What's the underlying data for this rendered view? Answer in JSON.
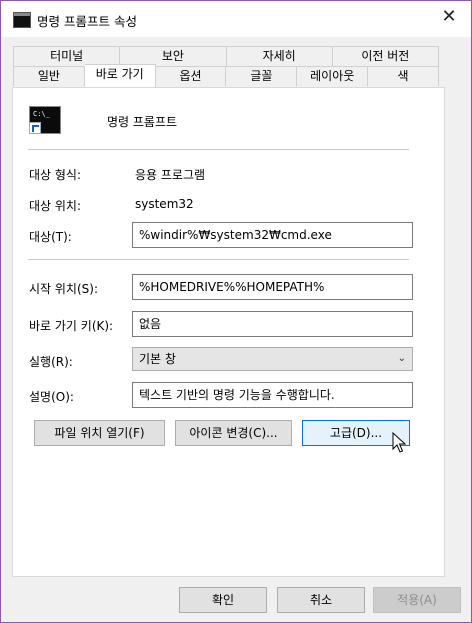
{
  "window": {
    "title": "명령 프롬프트 속성",
    "close_glyph": "✕",
    "border_color": "#8a5ba8"
  },
  "tabs": {
    "row1": [
      "터미널",
      "보안",
      "자세히",
      "이전 버전"
    ],
    "row2": [
      "일반",
      "바로 가기",
      "옵션",
      "글꼴",
      "레이아웃",
      "색"
    ],
    "active": "바로 가기"
  },
  "header": {
    "name": "명령 프롬프트",
    "icon": "cmd-shortcut-icon"
  },
  "fields": {
    "type_label": "대상 형식:",
    "type_value": "응용 프로그램",
    "location_label": "대상 위치:",
    "location_value": "system32",
    "target_label": "대상(T):",
    "target_value": "%windir%₩system32₩cmd.exe",
    "start_label": "시작 위치(S):",
    "start_value": "%HOMEDRIVE%%HOMEPATH%",
    "hotkey_label": "바로 가기 키(K):",
    "hotkey_value": "없음",
    "run_label": "실행(R):",
    "run_value": "기본 창",
    "comment_label": "설명(O):",
    "comment_value": "텍스트 기반의 명령 기능을 수행합니다."
  },
  "buttons": {
    "open_location": "파일 위치 열기(F)",
    "change_icon": "아이콘 변경(C)...",
    "advanced": "고급(D)...",
    "ok": "확인",
    "cancel": "취소",
    "apply": "적용(A)"
  },
  "colors": {
    "accent": "#0078d7",
    "panel": "#ffffff",
    "dialog": "#f0f0f0"
  }
}
